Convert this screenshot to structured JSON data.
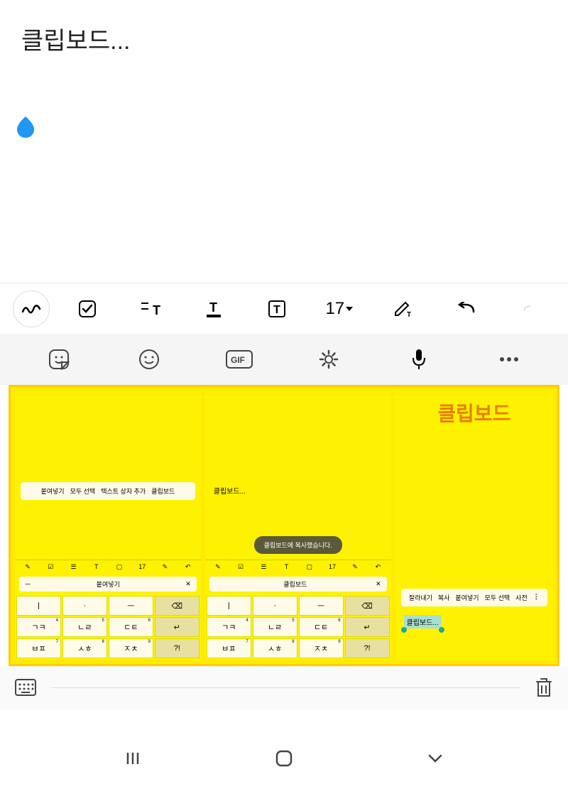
{
  "note": {
    "text": "클립보드..."
  },
  "format_toolbar": {
    "font_size": "17"
  },
  "clipboard": {
    "title": "클립보드",
    "col1": {
      "menu": [
        "붙여넣기",
        "모두 선택",
        "텍스트 상자 추가",
        "클립보드"
      ],
      "toolbar_size": "17",
      "suggestion_prefix": "ㅡ",
      "suggestion": "붙여넣기",
      "keys_r1": [
        "ㅣ",
        "·",
        "ㅡ",
        "⌫"
      ],
      "keys_r2": [
        "ㄱㅋ",
        "ㄴㄹ",
        "ㄷㅌ",
        "↵"
      ],
      "keys_r3": [
        "ㅂㅍ",
        "ㅅㅎ",
        "ㅈㅊ",
        "?!"
      ],
      "sups_r2": [
        "4",
        "5",
        "6",
        ""
      ],
      "sups_r3": [
        "7",
        "8",
        "9",
        ""
      ]
    },
    "col2": {
      "text": "클립보드...",
      "toast": "클립보드에 복사했습니다.",
      "toolbar_size": "17",
      "suggestion": "클립보드",
      "keys_r1": [
        "ㅣ",
        "·",
        "ㅡ",
        "⌫"
      ],
      "keys_r2": [
        "ㄱㅋ",
        "ㄴㄹ",
        "ㄷㅌ",
        "↵"
      ],
      "keys_r3": [
        "ㅂㅍ",
        "ㅅㅎ",
        "ㅈㅊ",
        "?!"
      ],
      "sups_r2": [
        "4",
        "5",
        "6",
        ""
      ],
      "sups_r3": [
        "7",
        "8",
        "9",
        ""
      ]
    },
    "col3": {
      "menu": [
        "잘라내기",
        "복사",
        "붙여넣기",
        "모두 선택",
        "사전"
      ],
      "selected": "클립보드..."
    }
  },
  "nav": {
    "recent": "|||",
    "home": "○",
    "back": "⌄"
  }
}
